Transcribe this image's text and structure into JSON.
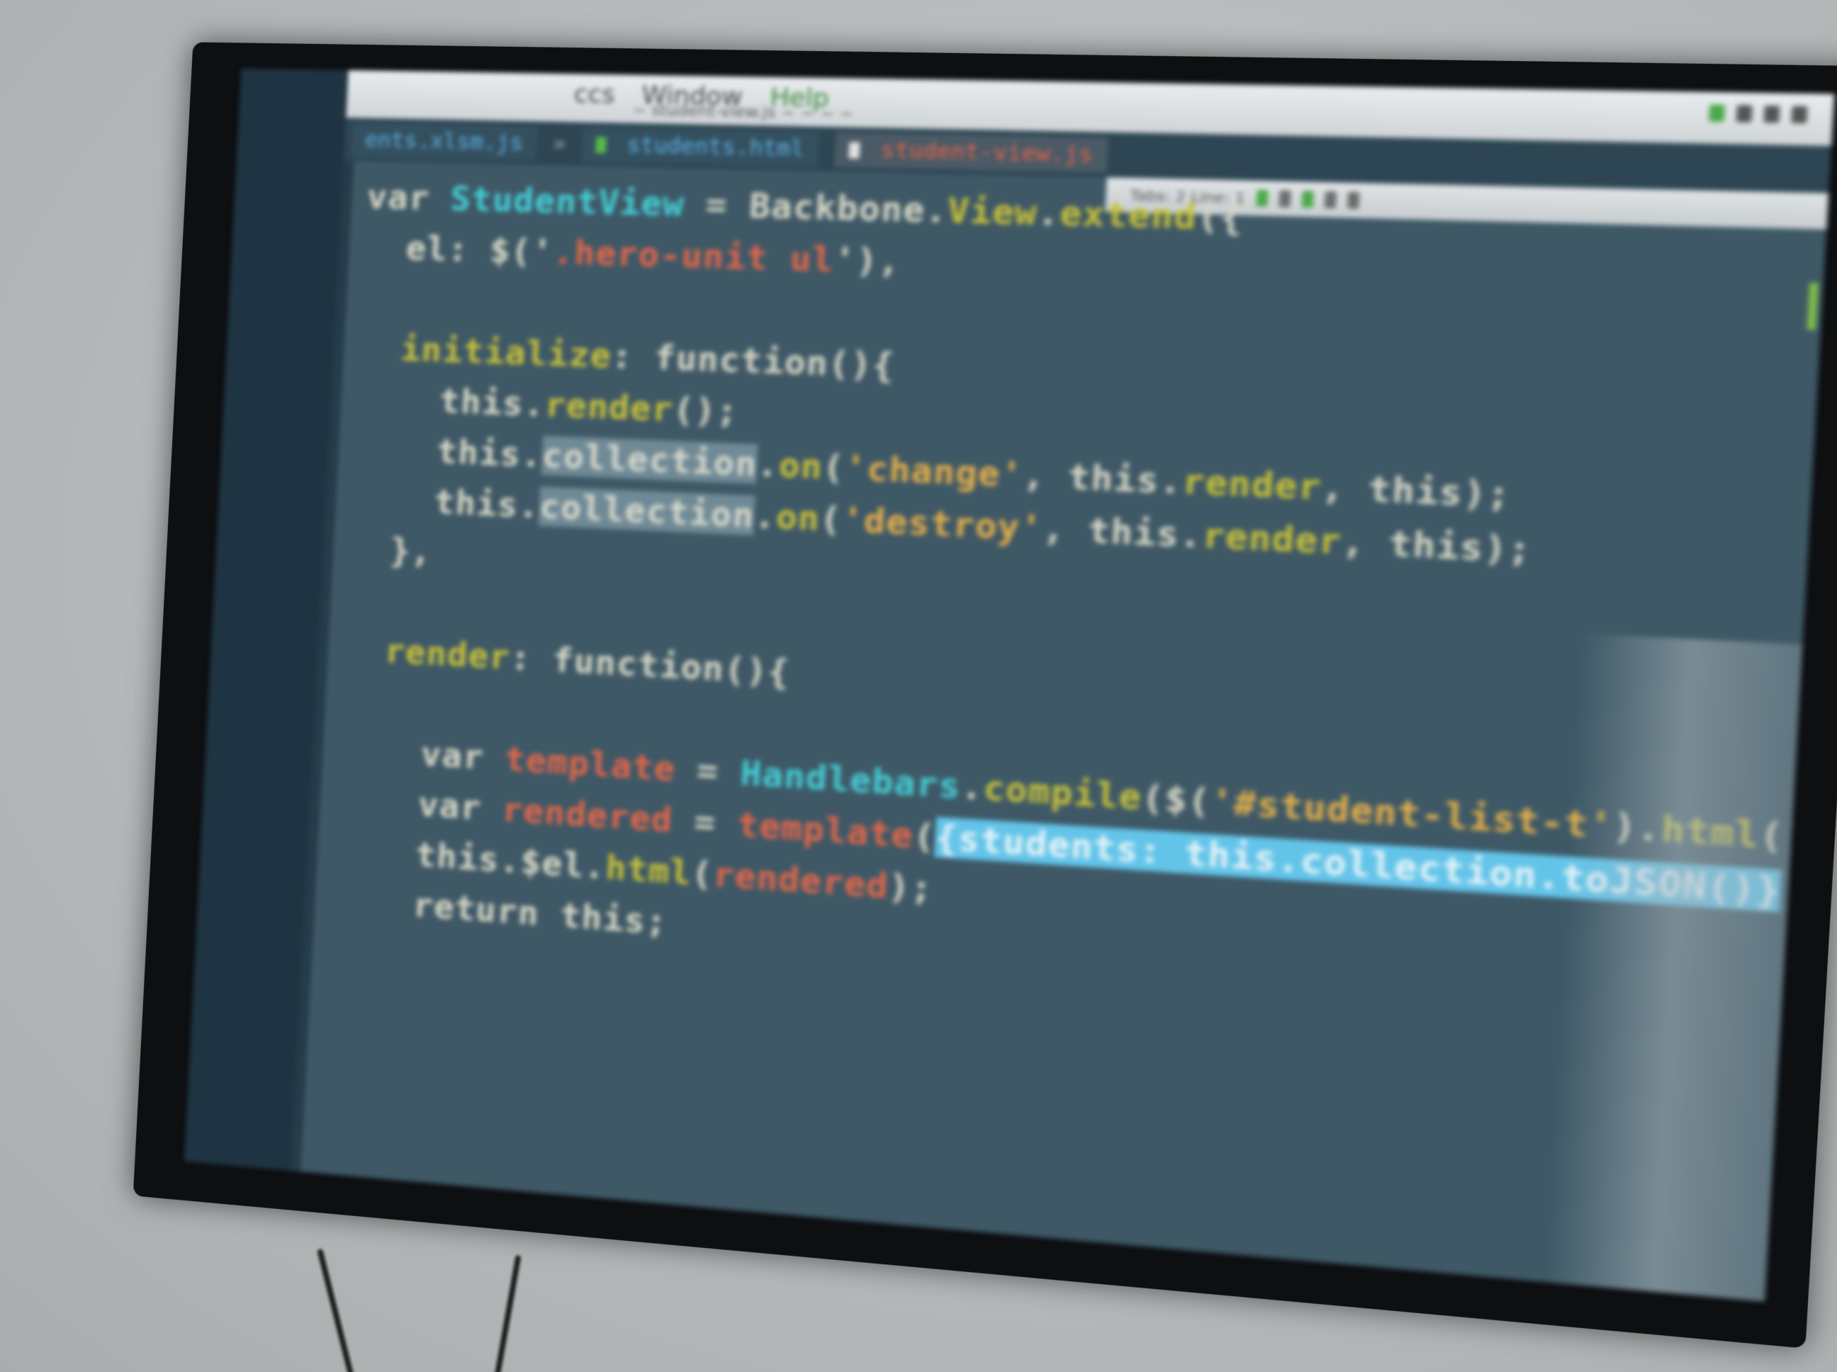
{
  "window": {
    "menu": [
      "ccs",
      "Window",
      "Help"
    ],
    "path": "~ student-view.js ~ ~ ~ ~"
  },
  "tabs": [
    {
      "label": "ents.xlsm.js"
    },
    {
      "label": "students.html"
    },
    {
      "label": "student-view.js"
    }
  ],
  "tab_separator": "»",
  "toolbar": {
    "text": "Tabs: 2  Line: 1"
  },
  "code": {
    "lines": [
      [
        [
          "kw",
          "var "
        ],
        [
          "cls",
          "StudentView"
        ],
        [
          "kw",
          " = Backbone."
        ],
        [
          "fn",
          "View"
        ],
        [
          "kw",
          "."
        ],
        [
          "fn",
          "extend"
        ],
        [
          "kw",
          "({"
        ]
      ],
      [
        [
          "kw",
          "  el: $('"
        ],
        [
          "var",
          ".hero-unit ul"
        ],
        [
          "kw",
          "'),"
        ]
      ],
      [
        [
          "kw",
          ""
        ]
      ],
      [
        [
          "fn",
          "  initialize"
        ],
        [
          "kw",
          ": function(){"
        ]
      ],
      [
        [
          "kw",
          "    this."
        ],
        [
          "fn",
          "render"
        ],
        [
          "kw",
          "();"
        ]
      ],
      [
        [
          "kw",
          "    this."
        ],
        [
          "sel",
          "collection"
        ],
        [
          "kw",
          "."
        ],
        [
          "fn",
          "on"
        ],
        [
          "kw",
          "("
        ],
        [
          "str",
          "'change'"
        ],
        [
          "kw",
          ", this."
        ],
        [
          "fn",
          "render"
        ],
        [
          "kw",
          ", this);"
        ]
      ],
      [
        [
          "kw",
          "    this."
        ],
        [
          "sel",
          "collection"
        ],
        [
          "kw",
          "."
        ],
        [
          "fn",
          "on"
        ],
        [
          "kw",
          "("
        ],
        [
          "str",
          "'destroy'"
        ],
        [
          "kw",
          ", this."
        ],
        [
          "fn",
          "render"
        ],
        [
          "kw",
          ", this);"
        ]
      ],
      [
        [
          "kw",
          "  },"
        ]
      ],
      [
        [
          "kw",
          ""
        ]
      ],
      [
        [
          "fn",
          "  render"
        ],
        [
          "kw",
          ": function(){"
        ]
      ],
      [
        [
          "kw",
          ""
        ]
      ],
      [
        [
          "kw",
          "    var "
        ],
        [
          "var",
          "template"
        ],
        [
          "kw",
          " = "
        ],
        [
          "cls",
          "Handlebars"
        ],
        [
          "kw",
          "."
        ],
        [
          "fn",
          "compile"
        ],
        [
          "kw",
          "($("
        ],
        [
          "str",
          "'#student-list-t'"
        ],
        [
          "kw",
          ")."
        ],
        [
          "fn",
          "html"
        ],
        [
          "kw",
          "());"
        ]
      ],
      [
        [
          "kw",
          "    var "
        ],
        [
          "var",
          "rendered"
        ],
        [
          "kw",
          " = "
        ],
        [
          "var",
          "template"
        ],
        [
          "kw",
          "("
        ],
        [
          "hl",
          "{students: this.collection.toJSON()}"
        ],
        [
          "kw",
          ");"
        ]
      ],
      [
        [
          "kw",
          "    this.$el."
        ],
        [
          "fn",
          "html"
        ],
        [
          "kw",
          "("
        ],
        [
          "var",
          "rendered"
        ],
        [
          "kw",
          ");"
        ]
      ],
      [
        [
          "kw",
          "    return this;"
        ]
      ]
    ]
  },
  "colors": {
    "screen_bg": "#3e5866",
    "keyword": "#d8d8c6",
    "class": "#45d0d8",
    "string": "#e6b04a",
    "function": "#c8c23a",
    "variable": "#e4674a",
    "highlight": "#63c4e9"
  }
}
